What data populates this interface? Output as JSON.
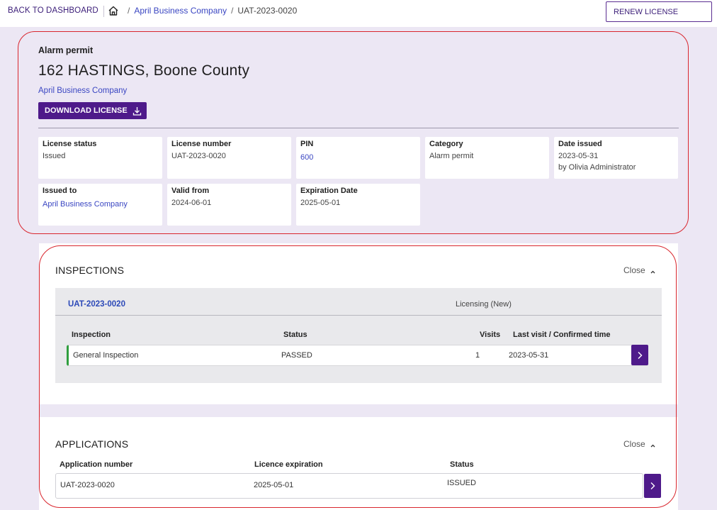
{
  "topbar": {
    "back_label": "BACK TO DASHBOARD",
    "breadcrumb": {
      "home_icon": "home-icon",
      "company": "April Business Company",
      "current": "UAT-2023-0020"
    },
    "renew_label": "RENEW LICENSE"
  },
  "license": {
    "permit_type": "Alarm permit",
    "address": "162 HASTINGS, Boone County",
    "company": "April Business Company",
    "download_label": "DOWNLOAD LICENSE",
    "download_icon": "download-icon",
    "fields": {
      "status": {
        "label": "License status",
        "value": "Issued"
      },
      "number": {
        "label": "License number",
        "value": "UAT-2023-0020"
      },
      "pin": {
        "label": "PIN",
        "value": "600"
      },
      "category": {
        "label": "Category",
        "value": "Alarm permit"
      },
      "date_issued": {
        "label": "Date issued",
        "value": "2023-05-31",
        "by": "by Olivia Administrator"
      },
      "issued_to": {
        "label": "Issued to",
        "value": "April Business Company"
      },
      "valid_from": {
        "label": "Valid from",
        "value": "2024-06-01"
      },
      "expiration": {
        "label": "Expiration Date",
        "value": "2025-05-01"
      }
    }
  },
  "inspections": {
    "title": "INSPECTIONS",
    "close_label": "Close",
    "record_id": "UAT-2023-0020",
    "record_type": "Licensing (New)",
    "headers": {
      "inspection": "Inspection",
      "status": "Status",
      "visits": "Visits",
      "last_visit": "Last visit / Confirmed time"
    },
    "rows": [
      {
        "inspection": "General Inspection",
        "status": "PASSED",
        "visits": "1",
        "last_visit": "2023-05-31"
      }
    ]
  },
  "applications": {
    "title": "APPLICATIONS",
    "close_label": "Close",
    "headers": {
      "number": "Application number",
      "expiration": "Licence expiration",
      "status": "Status"
    },
    "rows": [
      {
        "number": "UAT-2023-0020",
        "expiration": "2025-05-01",
        "status": "ISSUED"
      }
    ]
  },
  "colors": {
    "brand": "#4e1a8a",
    "link": "#3a46c2",
    "page_bg": "#ece7f4",
    "annotation": "#d9262e",
    "passed_accent": "#2f9e3e"
  }
}
